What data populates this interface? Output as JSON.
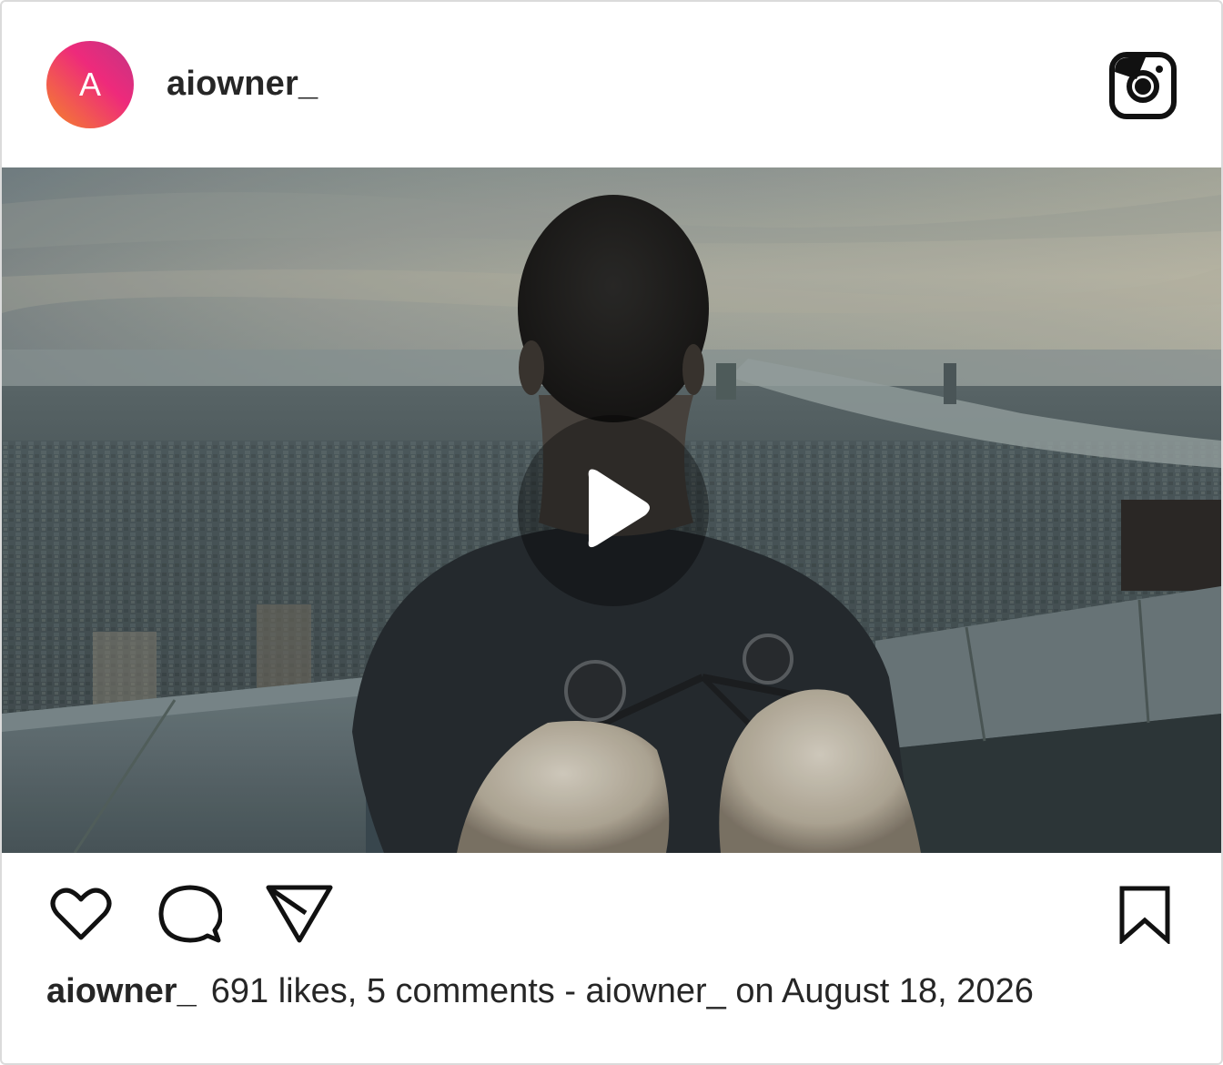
{
  "post": {
    "avatar_letter": "A",
    "username": "aiowner_",
    "brand_icon": "instagram-icon",
    "media": {
      "type": "video",
      "play_icon": "play-icon"
    },
    "actions": {
      "like_icon": "heart-icon",
      "comment_icon": "comment-icon",
      "share_icon": "send-icon",
      "save_icon": "bookmark-icon"
    },
    "caption": {
      "username": "aiowner_",
      "text": "691 likes, 5 comments - aiowner_ on August 18, 2026"
    }
  },
  "colors": {
    "text": "#262626",
    "border": "#dbdbdb",
    "avatar_gradient_start": "#f58529",
    "avatar_gradient_end": "#c13584"
  }
}
